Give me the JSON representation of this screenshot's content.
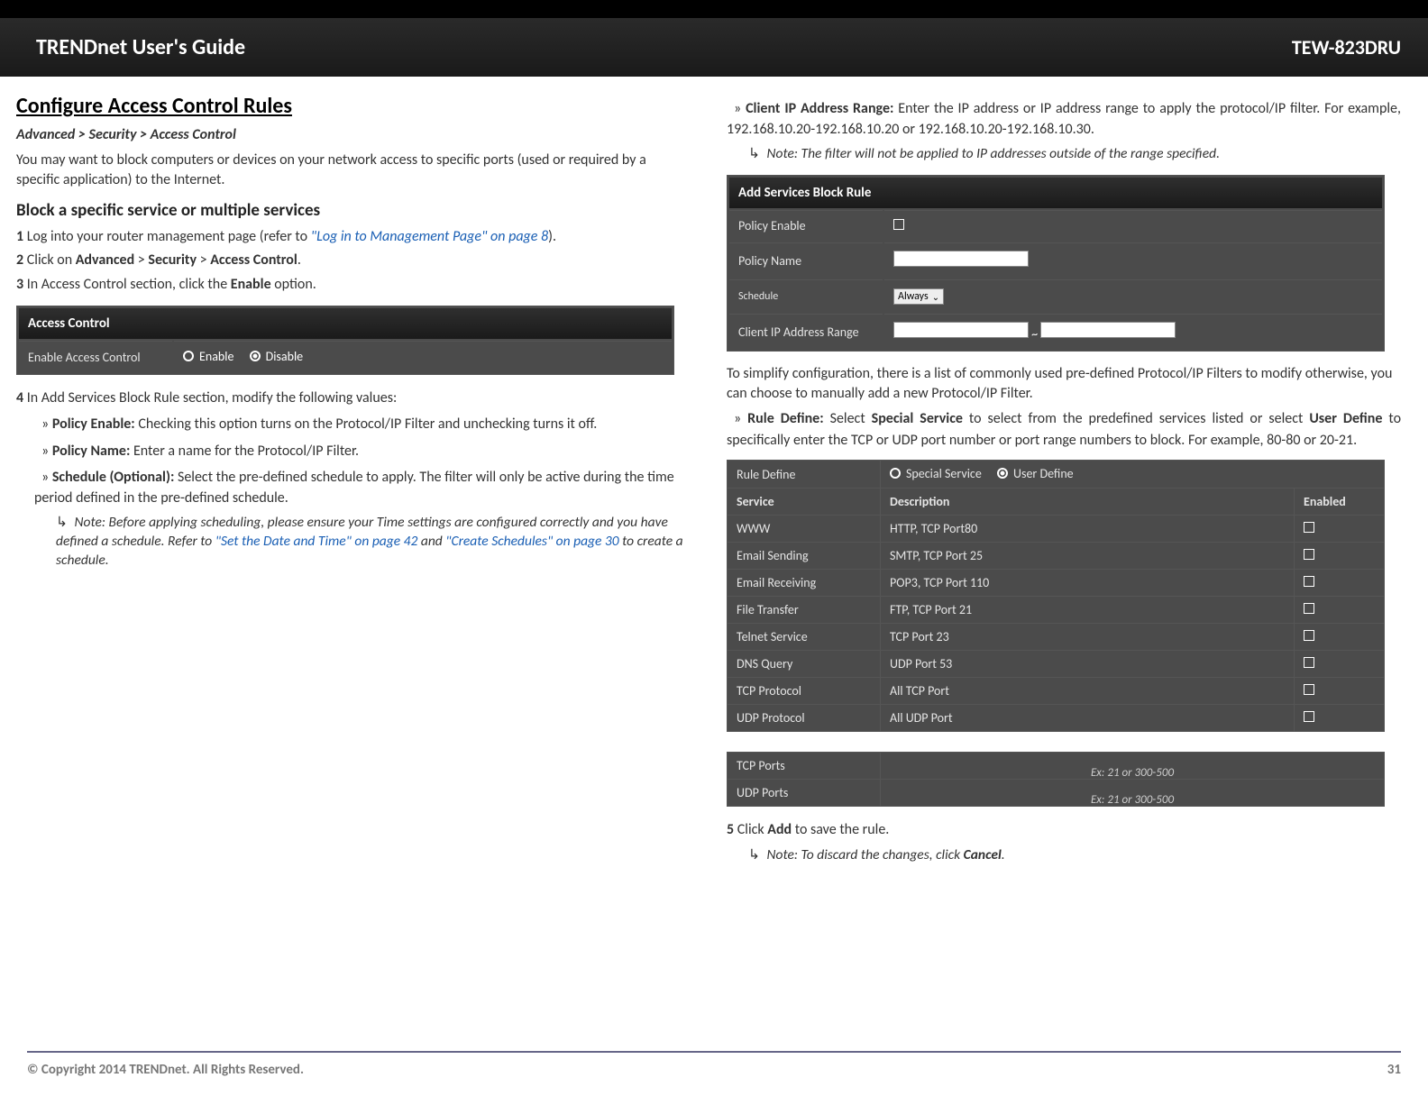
{
  "header": {
    "title": "TRENDnet User's Guide",
    "model": "TEW-823DRU"
  },
  "section_title": "Configure Access Control Rules",
  "breadcrumb": "Advanced > Security > Access Control",
  "intro": "You may want to block computers or devices on your network access to specific ports (used or required by a specific application) to the Internet.",
  "subsection": "Block a specific service or multiple services",
  "step1_prefix": "Log into your router management page (refer to ",
  "step1_link": "\"Log in to Management Page\" on page 8",
  "step1_suffix": ").",
  "step2_a": "Click on ",
  "step2_b": "Advanced",
  "step2_c": " > ",
  "step2_d": "Security",
  "step2_e": " > ",
  "step2_f": "Access Control",
  "step2_g": ".",
  "step3_a": "In Access Control section, click the ",
  "step3_b": "Enable",
  "step3_c": " option.",
  "panel1": {
    "head": "Access Control",
    "row_label": "Enable Access Control",
    "enable": "Enable",
    "disable": "Disable"
  },
  "step4": "In Add Services Block Rule section, modify the following values:",
  "s4_pe_label": "Policy Enable:",
  "s4_pe_text": " Checking this option turns on the Protocol/IP Filter and unchecking turns it off.",
  "s4_pn_label": "Policy Name:",
  "s4_pn_text": " Enter a name for the Protocol/IP Filter.",
  "s4_sc_label": "Schedule (Optional):",
  "s4_sc_text": " Select the  pre-defined schedule to apply. The filter will only be active during the time period defined in the pre-defined schedule.",
  "note1_a": "Note: Before applying scheduling, please ensure your Time settings are configured correctly and you have defined a schedule. Refer to ",
  "note1_link1": "\"Set the Date and Time\" on page 42",
  "note1_b": " and ",
  "note1_link2": "\"Create Schedules\" on page 30",
  "note1_c": " to create a schedule.",
  "cip_label": "Client IP Address Range:",
  "cip_text": " Enter the IP address or IP address range to apply the protocol/IP filter. For example, 192.168.10.20-192.168.10.20 or 192.168.10.20-192.168.10.30.",
  "note2": "Note: The filter will not be applied to IP addresses outside of the range specified.",
  "panel2": {
    "head": "Add Services Block Rule",
    "r1": "Policy Enable",
    "r2": "Policy Name",
    "r3": "Schedule",
    "r3_val": "Always",
    "r4": "Client IP Address Range",
    "tilde": "~"
  },
  "simplify": "To simplify configuration, there is a list of commonly used pre-defined Protocol/IP Filters to modify otherwise, you can choose to manually add a new Protocol/IP Filter.",
  "rd_label": "Rule Define:",
  "rd_a": " Select ",
  "rd_b": "Special Service",
  "rd_c": " to select from the predefined services listed or select ",
  "rd_d": "User Define",
  "rd_e": " to specifically enter the TCP or UDP port number or port range numbers to block. For example, 80-80 or 20-21.",
  "svc": {
    "rd_label": "Rule Define",
    "opt1": "Special Service",
    "opt2": "User Define",
    "h1": "Service",
    "h2": "Description",
    "h3": "Enabled",
    "rows": [
      {
        "s": "WWW",
        "d": "HTTP, TCP Port80"
      },
      {
        "s": "Email Sending",
        "d": "SMTP, TCP Port 25"
      },
      {
        "s": "Email Receiving",
        "d": "POP3, TCP Port 110"
      },
      {
        "s": "File Transfer",
        "d": "FTP, TCP Port 21"
      },
      {
        "s": "Telnet Service",
        "d": "TCP Port 23"
      },
      {
        "s": "DNS Query",
        "d": "UDP Port 53"
      },
      {
        "s": "TCP Protocol",
        "d": "All TCP Port"
      },
      {
        "s": "UDP Protocol",
        "d": "All UDP Port"
      }
    ]
  },
  "ports": {
    "r1": "TCP Ports",
    "r2": "UDP Ports",
    "ph": "Ex: 21 or 300-500"
  },
  "step5_a": "Click ",
  "step5_b": "Add",
  "step5_c": " to save the rule.",
  "note3_a": "Note: To discard the changes, click ",
  "note3_b": "Cancel",
  "note3_c": ".",
  "footer": {
    "copyright": "© Copyright 2014 TRENDnet. All Rights Reserved.",
    "page": "31"
  }
}
